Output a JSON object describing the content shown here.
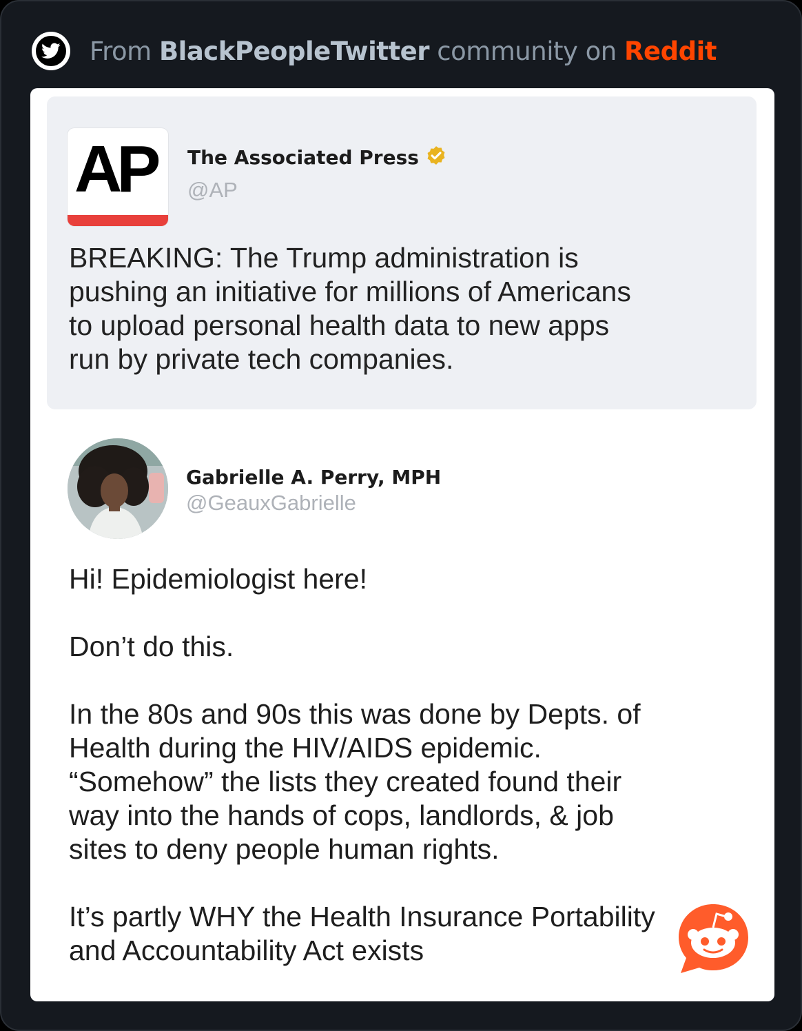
{
  "header": {
    "prefix": "From ",
    "community": "BlackPeopleTwitter",
    "middle": " community on ",
    "platform": "Reddit",
    "icon": "twitter-bird-icon"
  },
  "ap_tweet": {
    "logo_text": "AP",
    "author_name": "The Associated Press",
    "handle": "@AP",
    "verified_icon": "verified-badge-icon",
    "lines": [
      "BREAKING: The Trump administration is",
      "pushing an initiative for millions of Americans",
      "to upload personal health data to new apps",
      "run by private tech companies."
    ]
  },
  "reply_tweet": {
    "author_name": "Gabrielle A. Perry, MPH",
    "handle": "@GeauxGabrielle",
    "paragraphs": [
      [
        "Hi! Epidemiologist here!"
      ],
      [
        "Don’t do this."
      ],
      [
        "In the 80s and 90s this was done by Depts. of",
        "Health during the HIV/AIDS epidemic.",
        "“Somehow” the lists they created found their",
        "way into the hands of cops, landlords, & job",
        "sites to deny people human rights."
      ],
      [
        "It’s partly WHY the Health Insurance Portability",
        "and Accountability Act exists"
      ]
    ]
  },
  "watermark": {
    "icon": "reddit-snoo-icon"
  },
  "colors": {
    "reddit": "#ff4500",
    "ap_red": "#e8403b",
    "verified_gold": "#e9b320"
  }
}
